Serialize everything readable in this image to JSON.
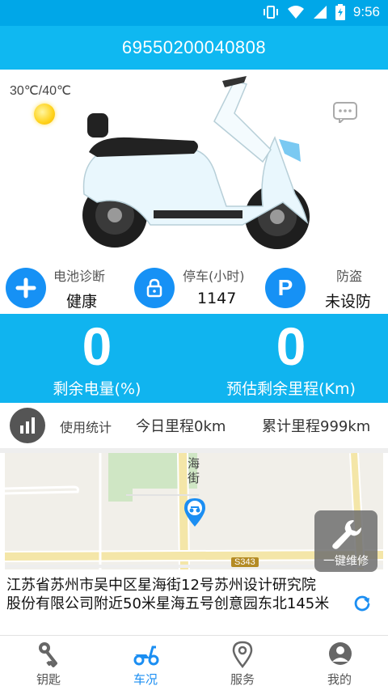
{
  "status_bar": {
    "time": "9:56",
    "icons": [
      "vibrate-icon",
      "wifi-icon",
      "signal-icon",
      "battery-charging-icon"
    ]
  },
  "header": {
    "title": "69550200040808"
  },
  "weather": {
    "temperature": "30℃/40℃",
    "icon": "sun-icon"
  },
  "stats": [
    {
      "icon": "plus-icon",
      "label": "电池诊断",
      "value": "健康"
    },
    {
      "icon": "lock-icon",
      "label": "停车(小时)",
      "value": "1147"
    },
    {
      "icon": "parking-icon",
      "label": "防盗",
      "value": "未设防"
    }
  ],
  "metrics": [
    {
      "value": "0",
      "label": "剩余电量(%)"
    },
    {
      "value": "0",
      "label": "预估剩余里程(Km)"
    }
  ],
  "usage": {
    "label": "使用统计",
    "today": "今日里程0km",
    "total": "累计里程999km"
  },
  "map": {
    "road_label_1": "海",
    "road_label_2": "街",
    "road_badge": "S343"
  },
  "repair_button": {
    "label": "一键维修"
  },
  "address": {
    "text": "江苏省苏州市吴中区星海街12号苏州设计研究院股份有限公司附近50米星海五号创意园东北145米"
  },
  "nav": [
    {
      "label": "钥匙",
      "icon": "key-icon",
      "active": false
    },
    {
      "label": "车况",
      "icon": "scooter-icon",
      "active": true
    },
    {
      "label": "服务",
      "icon": "location-pin-icon",
      "active": false
    },
    {
      "label": "我的",
      "icon": "user-icon",
      "active": false
    }
  ],
  "colors": {
    "primary": "#10b4ef",
    "accent": "#1691f5",
    "active_tab": "#1b8ef2"
  }
}
